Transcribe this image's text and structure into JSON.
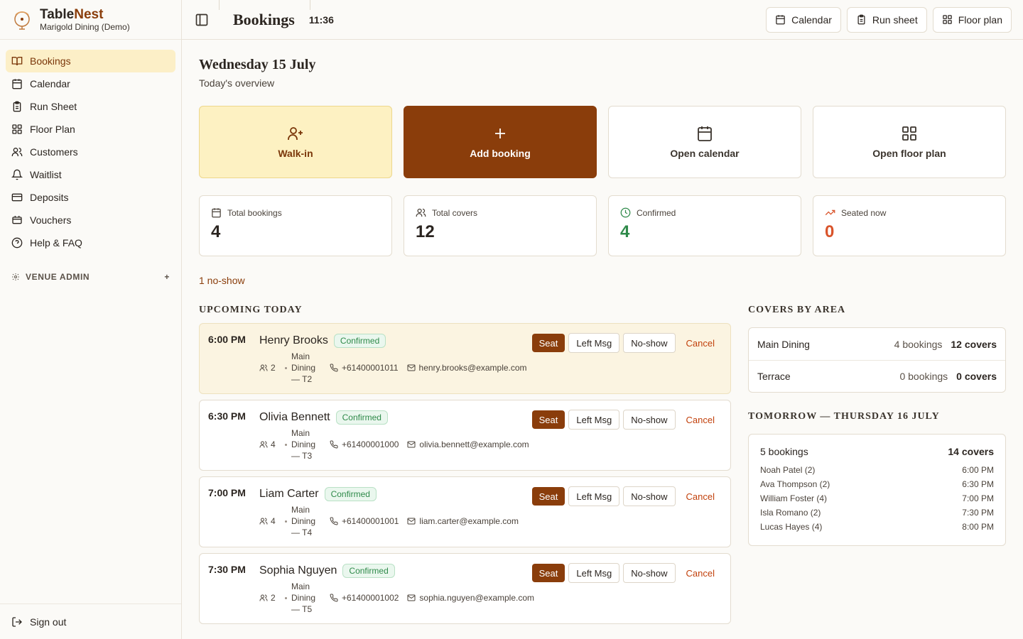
{
  "brand": {
    "name_a": "Table",
    "name_b": "Nest",
    "venue": "Marigold Dining (Demo)"
  },
  "nav": [
    {
      "label": "Bookings",
      "icon": "book-open-icon",
      "active": true
    },
    {
      "label": "Calendar",
      "icon": "calendar-icon"
    },
    {
      "label": "Run Sheet",
      "icon": "clipboard-icon"
    },
    {
      "label": "Floor Plan",
      "icon": "grid-icon"
    },
    {
      "label": "Customers",
      "icon": "users-icon"
    },
    {
      "label": "Waitlist",
      "icon": "bell-icon"
    },
    {
      "label": "Deposits",
      "icon": "wallet-icon"
    },
    {
      "label": "Vouchers",
      "icon": "ticket-icon"
    },
    {
      "label": "Help & FAQ",
      "icon": "help-circle-icon"
    }
  ],
  "nav_section": {
    "label": "VENUE ADMIN",
    "toggle": "+"
  },
  "signout": "Sign out",
  "topbar": {
    "title": "Bookings",
    "clock": "11:36",
    "actions": [
      "Calendar",
      "Run sheet",
      "Floor plan"
    ]
  },
  "overview": {
    "date": "Wednesday 15 July",
    "subtitle": "Today's overview"
  },
  "action_cards": [
    "Walk-in",
    "Add booking",
    "Open calendar",
    "Open floor plan"
  ],
  "stats": [
    {
      "label": "Total bookings",
      "value": "4"
    },
    {
      "label": "Total covers",
      "value": "12"
    },
    {
      "label": "Confirmed",
      "value": "4"
    },
    {
      "label": "Seated now",
      "value": "0"
    }
  ],
  "noshow_text": "1 no-show",
  "upcoming": {
    "title": "UPCOMING TODAY",
    "bookings": [
      {
        "time": "6:00 PM",
        "name": "Henry Brooks",
        "status": "Confirmed",
        "party": "2",
        "area_l1": "Main",
        "area_l2": "Dining",
        "area_l3": "— T2",
        "phone": "+61400001011",
        "email": "henry.brooks@example.com"
      },
      {
        "time": "6:30 PM",
        "name": "Olivia Bennett",
        "status": "Confirmed",
        "party": "4",
        "area_l1": "Main",
        "area_l2": "Dining",
        "area_l3": "— T3",
        "phone": "+61400001000",
        "email": "olivia.bennett@example.com"
      },
      {
        "time": "7:00 PM",
        "name": "Liam Carter",
        "status": "Confirmed",
        "party": "4",
        "area_l1": "Main",
        "area_l2": "Dining",
        "area_l3": "— T4",
        "phone": "+61400001001",
        "email": "liam.carter@example.com"
      },
      {
        "time": "7:30 PM",
        "name": "Sophia Nguyen",
        "status": "Confirmed",
        "party": "2",
        "area_l1": "Main",
        "area_l2": "Dining",
        "area_l3": "— T5",
        "phone": "+61400001002",
        "email": "sophia.nguyen@example.com"
      }
    ],
    "actions": {
      "seat": "Seat",
      "left_msg": "Left Msg",
      "noshow": "No-show",
      "cancel": "Cancel"
    }
  },
  "covers_by_area": {
    "title": "COVERS BY AREA",
    "rows": [
      {
        "area": "Main Dining",
        "bookings": "4 bookings",
        "covers": "12 covers"
      },
      {
        "area": "Terrace",
        "bookings": "0 bookings",
        "covers": "0 covers"
      }
    ]
  },
  "tomorrow": {
    "title": "TOMORROW — THURSDAY 16 JULY",
    "bookings": "5 bookings",
    "covers": "14 covers",
    "list": [
      {
        "name": "Noah Patel (2)",
        "time": "6:00 PM"
      },
      {
        "name": "Ava Thompson (2)",
        "time": "6:30 PM"
      },
      {
        "name": "William Foster (4)",
        "time": "7:00 PM"
      },
      {
        "name": "Isla Romano (2)",
        "time": "7:30 PM"
      },
      {
        "name": "Lucas Hayes (4)",
        "time": "8:00 PM"
      }
    ]
  },
  "colors": {
    "accent": "#8a3d0b",
    "active_bg": "#fcefc7",
    "confirmed": "#2f8a4a",
    "seated": "#d9542b"
  }
}
